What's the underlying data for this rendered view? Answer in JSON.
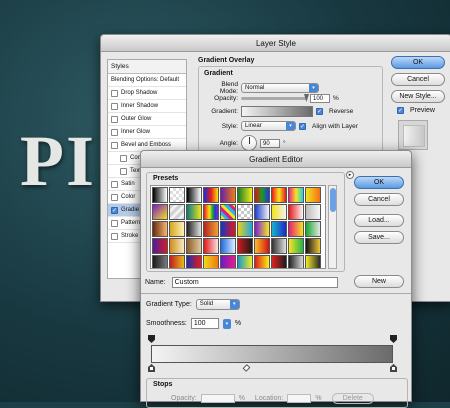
{
  "background_text": "PI",
  "layer_style": {
    "title": "Layer Style",
    "styles_header": "Styles",
    "blending_options": "Blending Options: Default",
    "items": [
      {
        "label": "Drop Shadow",
        "checked": false,
        "sub": false
      },
      {
        "label": "Inner Shadow",
        "checked": false,
        "sub": false
      },
      {
        "label": "Outer Glow",
        "checked": false,
        "sub": false
      },
      {
        "label": "Inner Glow",
        "checked": false,
        "sub": false
      },
      {
        "label": "Bevel and Emboss",
        "checked": false,
        "sub": false
      },
      {
        "label": "Cont",
        "checked": false,
        "sub": true
      },
      {
        "label": "Text",
        "checked": false,
        "sub": true
      },
      {
        "label": "Satin",
        "checked": false,
        "sub": false
      },
      {
        "label": "Color",
        "checked": false,
        "sub": false
      },
      {
        "label": "Gradie",
        "checked": true,
        "sub": false,
        "selected": true
      },
      {
        "label": "Pattern",
        "checked": false,
        "sub": false
      },
      {
        "label": "Stroke",
        "checked": false,
        "sub": false
      }
    ],
    "section_title": "Gradient Overlay",
    "subsection_title": "Gradient",
    "blend_mode_label": "Blend Mode:",
    "blend_mode_value": "Normal",
    "opacity_label": "Opacity:",
    "opacity_value": "100",
    "percent": "%",
    "gradient_label": "Gradient:",
    "reverse_label": "Reverse",
    "reverse_checked": true,
    "style_label": "Style:",
    "style_value": "Linear",
    "align_label": "Align with Layer",
    "align_checked": true,
    "angle_label": "Angle:",
    "angle_value": "90",
    "degree": "°",
    "buttons": {
      "ok": "OK",
      "cancel": "Cancel",
      "new_style": "New Style..."
    },
    "preview_label": "Preview",
    "preview_checked": true
  },
  "gradient_editor": {
    "title": "Gradient Editor",
    "presets_label": "Presets",
    "presets_menu_icon": "play-arrow-icon",
    "preset_swatches": [
      "linear-gradient(90deg,#000,#fff)",
      "repeating-conic-gradient(#ddd 0 25%,#fff 0 50%) 0 0/6px 6px",
      "linear-gradient(90deg,#000,#fff)",
      "linear-gradient(90deg,#1f2bd8,#e41c1c,#f6e30f)",
      "linear-gradient(90deg,#6b1fa6,#f07d14)",
      "linear-gradient(90deg,#1a7c22,#f3ec21)",
      "linear-gradient(90deg,#e31010,#1e9b20,#2037e0)",
      "linear-gradient(90deg,#ee1a1a,#f7e71b,#e01b1b)",
      "linear-gradient(90deg,#f21f8e,#f6e21a,#1ad2f0)",
      "linear-gradient(90deg,#f1e51f,#f47016)",
      "linear-gradient(135deg,#7c1bc7,#f2e31c)",
      "repeating-linear-gradient(135deg,#d2d2d2 0 3px,#f2f2f2 3px 6px)",
      "linear-gradient(90deg,#0a7b7c,#f1e61b)",
      "linear-gradient(90deg,#eb1a1a,#f2821a,#f2e41a,#1ead24,#1e39db,#9123d2)",
      "repeating-linear-gradient(45deg,#f2e31b 0 3px,#20b9e8 3px 6px,#e11b8a 6px 9px)",
      "repeating-conic-gradient(#c8c8c8 0 25%,#fff 0 50%) 0 0/6px 6px",
      "linear-gradient(90deg,#1c3fd2,#f4f4f4)",
      "linear-gradient(90deg,#f1e11b,#f3f3f3)",
      "linear-gradient(90deg,#ea1a1a,#f8f8f8)",
      "linear-gradient(90deg,#bdbdbd,#f6f6f6)",
      "linear-gradient(90deg,#6a2911,#f5b86f)",
      "linear-gradient(90deg,#d7a324,#fff3b1)",
      "linear-gradient(90deg,#212121,#e2e2e2)",
      "linear-gradient(90deg,#b32619,#f1a03a)",
      "linear-gradient(90deg,#1434c9,#e3161a)",
      "linear-gradient(90deg,#f0d012,#19a4e6)",
      "linear-gradient(90deg,#7e1fd1,#f2ea26)",
      "linear-gradient(90deg,#18b2cc,#1a2ac4)",
      "linear-gradient(90deg,#e61e7a,#f3e61e)",
      "linear-gradient(90deg,#17a72e,#e6e6e6)",
      "linear-gradient(90deg,#4e1b9c,#d31d26)",
      "linear-gradient(90deg,#cf8e1b,#f7eac0)",
      "linear-gradient(90deg,#8f5b2c,#e1cb9b)",
      "linear-gradient(90deg,#e31818,#f8e1e1)",
      "linear-gradient(90deg,#1c6be4,#dfeefc)",
      "linear-gradient(90deg,#cf1a1a,#1b1b1b)",
      "linear-gradient(90deg,#f7bf26,#d41212)",
      "linear-gradient(90deg,#323232,#e0e0e0)",
      "linear-gradient(90deg,#fde11e,#1db84b)",
      "linear-gradient(90deg,#111,#f0c73a)",
      "linear-gradient(90deg,#1a1a1a,#7a7a7a)",
      "linear-gradient(90deg,#c01e1e,#e9b91c)",
      "linear-gradient(90deg,#1a2fa8,#eb1a1a)",
      "linear-gradient(90deg,#f0d819,#f07814)",
      "linear-gradient(90deg,#6a1cc2,#eb1b8c)",
      "linear-gradient(90deg,#1398c9,#f0ef26)",
      "linear-gradient(90deg,#e21b1b,#f6f11b)",
      "linear-gradient(90deg,#e22222,#1c1c1c)",
      "linear-gradient(90deg,#222,#d8d8d8)",
      "linear-gradient(90deg,#f5ea27,#2a2a2a)"
    ],
    "buttons": {
      "ok": "OK",
      "cancel": "Cancel",
      "load": "Load...",
      "save": "Save...",
      "new": "New"
    },
    "name_label": "Name:",
    "name_value": "Custom",
    "gradient_type_label": "Gradient Type:",
    "gradient_type_value": "Solid",
    "smoothness_label": "Smoothness:",
    "smoothness_value": "100",
    "percent": "%",
    "stops_label": "Stops",
    "opacity_label": "Opacity:",
    "location_label": "Location:",
    "delete_label": "Delete",
    "colors": {
      "gradient_start": "#f4f4f4",
      "gradient_end": "#6b6b6b",
      "accent": "#4a86d8"
    }
  }
}
